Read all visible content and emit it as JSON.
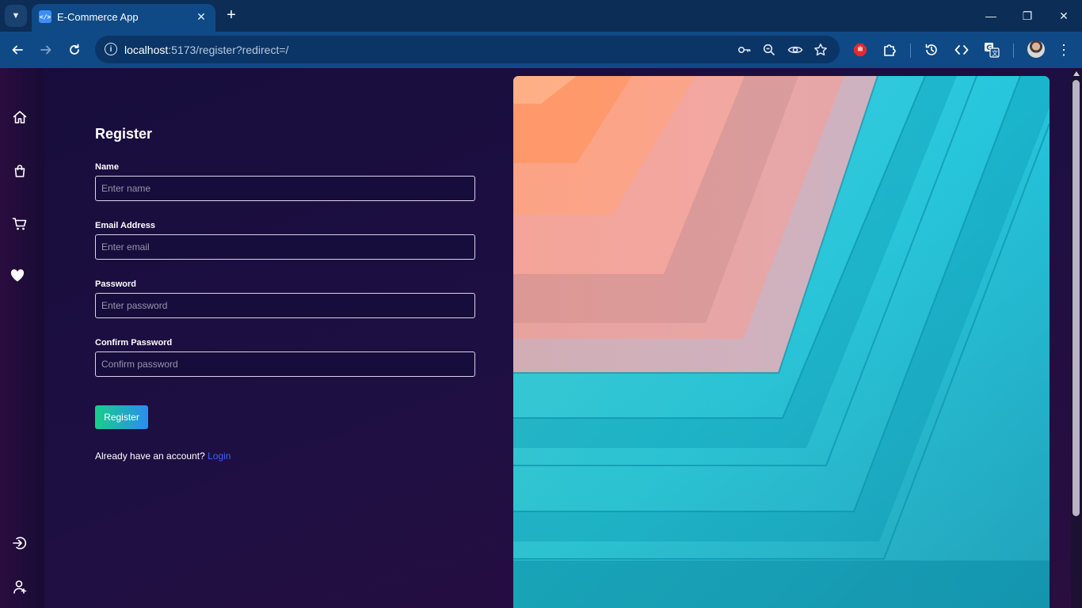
{
  "browser": {
    "tab_title": "E-Commerce App",
    "favicon_text": "</>",
    "url_host": "localhost",
    "url_rest": ":5173/register?redirect=/"
  },
  "sidebar": {
    "icons": [
      "home-icon",
      "shopping-bag-icon",
      "cart-icon",
      "heart-icon",
      "login-icon",
      "user-icon"
    ]
  },
  "form": {
    "heading": "Register",
    "name_label": "Name",
    "name_placeholder": "Enter name",
    "email_label": "Email Address",
    "email_placeholder": "Enter email",
    "password_label": "Password",
    "password_placeholder": "Enter password",
    "confirm_label": "Confirm Password",
    "confirm_placeholder": "Confirm password",
    "submit_label": "Register",
    "login_prompt": "Already have an account? ",
    "login_link": "Login"
  },
  "colors": {
    "accent_gradient_start": "#17cf8a",
    "accent_gradient_end": "#2b8cf0",
    "link": "#3e62f2",
    "background": "#170d3c"
  }
}
